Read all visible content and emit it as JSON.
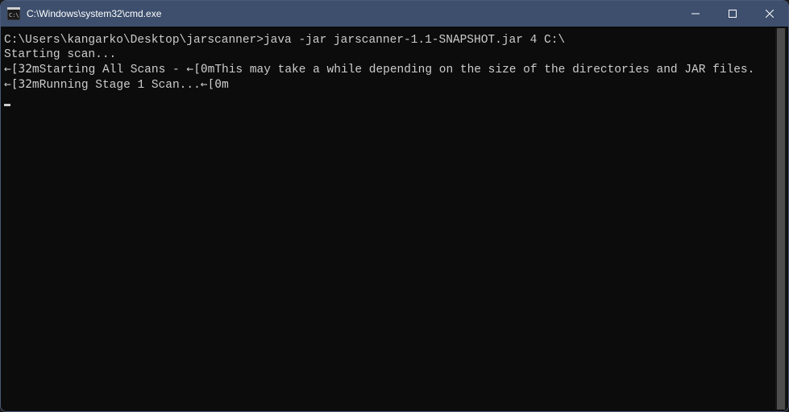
{
  "window": {
    "title": "C:\\Windows\\system32\\cmd.exe"
  },
  "terminal": {
    "prompt": "C:\\Users\\kangarko\\Desktop\\jarscanner>",
    "command": "java -jar jarscanner-1.1-SNAPSHOT.jar 4 C:\\",
    "line2": "Starting scan...",
    "line3_pre": "←[32m",
    "line3_mid1": "Starting All Scans - ",
    "line3_esc2": "←[0m",
    "line3_mid2": "This may take a while depending on the size of the directories and JAR files.",
    "line4_pre": "←[32m",
    "line4_mid": "Running Stage 1 Scan...",
    "line4_esc2": "←[0m"
  }
}
